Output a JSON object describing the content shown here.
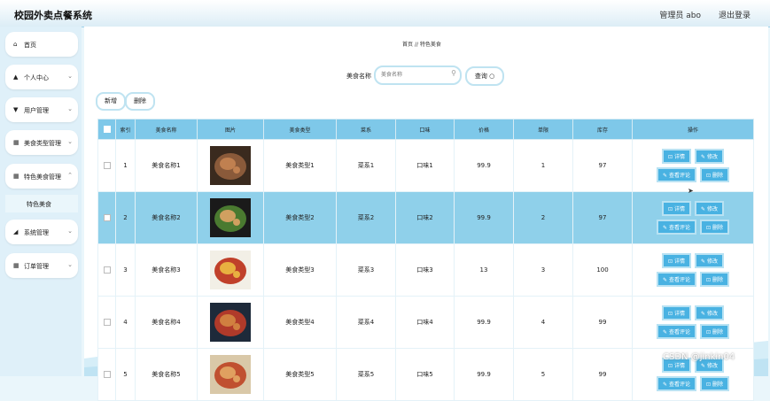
{
  "header": {
    "title": "校园外卖点餐系统",
    "admin": "管理员 abo",
    "logout": "退出登录"
  },
  "sidebar": {
    "items": [
      {
        "label": "首页",
        "icon": "home-icon",
        "glyph": "⌂",
        "has_chevron": false
      },
      {
        "label": "个人中心",
        "icon": "user-icon",
        "glyph": "▲",
        "has_chevron": true
      },
      {
        "label": "用户管理",
        "icon": "users-icon",
        "glyph": "▼",
        "has_chevron": true
      },
      {
        "label": "美食类型管理",
        "icon": "grid-icon",
        "glyph": "▦",
        "has_chevron": true
      },
      {
        "label": "特色美食管理",
        "icon": "grid-icon",
        "glyph": "▦",
        "has_chevron": true
      },
      {
        "label": "系统管理",
        "icon": "settings-icon",
        "glyph": "◢",
        "has_chevron": true
      },
      {
        "label": "订单管理",
        "icon": "grid-icon",
        "glyph": "▦",
        "has_chevron": true
      }
    ],
    "submenu": {
      "label": "特色美食"
    }
  },
  "breadcrumb": {
    "home": "首页",
    "sep": "//",
    "current": "特色美食"
  },
  "search": {
    "label": "美食名称",
    "placeholder": "美食名称",
    "button": "查询"
  },
  "actions": {
    "add": "新增",
    "delete": "删除"
  },
  "table": {
    "columns": [
      "索引",
      "美食名称",
      "图片",
      "美食类型",
      "菜系",
      "口味",
      "价格",
      "单限",
      "库存",
      "操作"
    ],
    "ops": {
      "detail": "详情",
      "edit": "修改",
      "review": "查看评论",
      "delete": "删除"
    },
    "rows": [
      {
        "index": "1",
        "name": "美食名称1",
        "type": "美食类型1",
        "cuisine": "菜系1",
        "taste": "口味1",
        "price": "99.9",
        "limit": "1",
        "stock": "97",
        "selected": false
      },
      {
        "index": "2",
        "name": "美食名称2",
        "type": "美食类型2",
        "cuisine": "菜系2",
        "taste": "口味2",
        "price": "99.9",
        "limit": "2",
        "stock": "97",
        "selected": true
      },
      {
        "index": "3",
        "name": "美食名称3",
        "type": "美食类型3",
        "cuisine": "菜系3",
        "taste": "口味3",
        "price": "13",
        "limit": "3",
        "stock": "100",
        "selected": false
      },
      {
        "index": "4",
        "name": "美食名称4",
        "type": "美食类型4",
        "cuisine": "菜系4",
        "taste": "口味4",
        "price": "99.9",
        "limit": "4",
        "stock": "99",
        "selected": false
      },
      {
        "index": "5",
        "name": "美食名称5",
        "type": "美食类型5",
        "cuisine": "菜系5",
        "taste": "口味5",
        "price": "99.9",
        "limit": "5",
        "stock": "99",
        "selected": false
      }
    ]
  },
  "watermark": "CSDN @jinkin04",
  "colors": {
    "header_th": "#7ec8e9",
    "selected_row": "#8fd0ea",
    "op_button": "#49b2e2",
    "sidebar": "#dff0f9"
  }
}
